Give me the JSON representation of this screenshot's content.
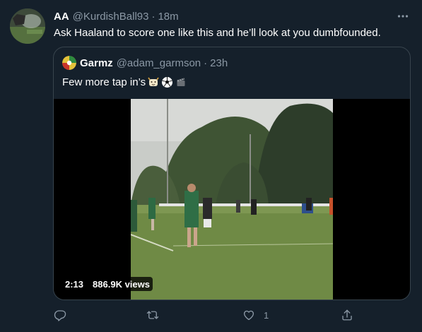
{
  "tweet": {
    "author_name": "AA",
    "author_handle": "@KurdishBall93",
    "separator": "·",
    "time": "18m",
    "text": "Ask Haaland to score one like this and he’ll look at you dumbfounded."
  },
  "quoted_tweet": {
    "author_name": "Garmz",
    "author_handle": "@adam_garmson",
    "separator": "·",
    "time": "23h",
    "text": "Few more tap in’s",
    "emojis": [
      "goat-icon",
      "soccer-ball-icon",
      "clapperboard-icon"
    ],
    "video": {
      "duration": "2:13",
      "views": "886.9K views"
    }
  },
  "actions": {
    "reply_count": "",
    "retweet_count": "",
    "like_count": "1"
  },
  "icons": {
    "more": "more-icon",
    "reply": "reply-icon",
    "retweet": "retweet-icon",
    "like": "like-icon",
    "share": "share-icon"
  },
  "colors": {
    "background": "#15202b",
    "text_primary": "#ffffff",
    "text_secondary": "#8b98a5",
    "border": "#38444d"
  }
}
